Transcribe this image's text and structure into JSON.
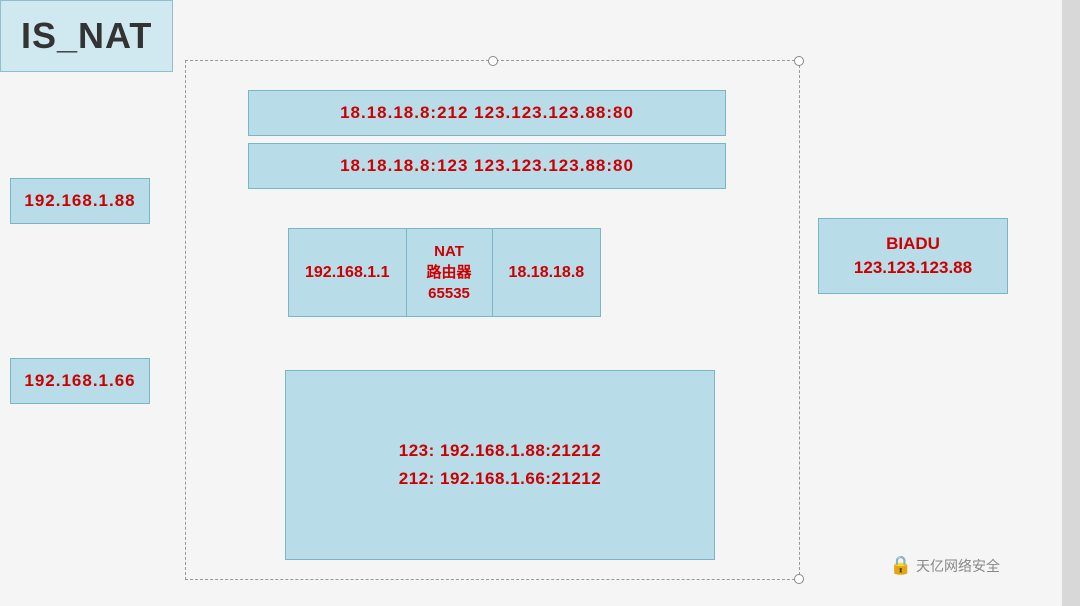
{
  "title": "IS_NAT",
  "conn_row1": {
    "label": "18.18.18.8:212    123.123.123.88:80"
  },
  "conn_row2": {
    "label": "18.18.18.8:123    123.123.123.88:80"
  },
  "left_node1": {
    "label": "192.168.1.88"
  },
  "left_node2": {
    "label": "192.168.1.66"
  },
  "nat_left": {
    "label": "192.168.1.1"
  },
  "nat_center_line1": "NAT",
  "nat_center_line2": "路由器",
  "nat_center_line3": "65535",
  "nat_right": {
    "label": "18.18.18.8"
  },
  "biadu_line1": "BIADU",
  "biadu_line2": "123.123.123.88",
  "table_row1": "123: 192.168.1.88:21212",
  "table_row2": "212: 192.168.1.66:21212",
  "watermark": "天亿网络安全"
}
